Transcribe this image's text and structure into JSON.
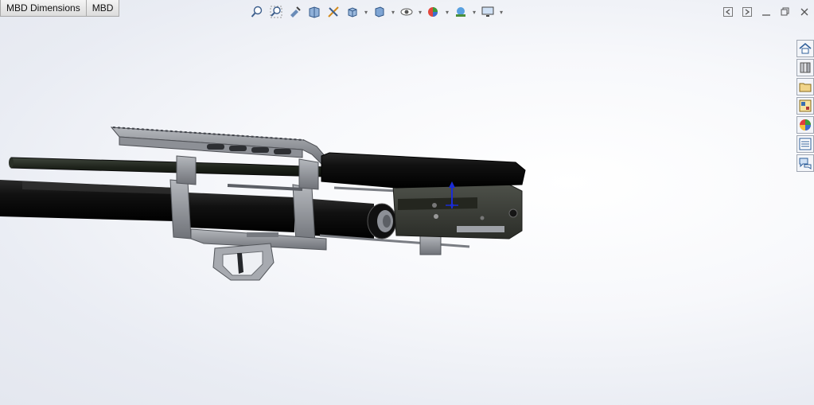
{
  "tabs": [
    {
      "label": "MBD Dimensions"
    },
    {
      "label": "MBD"
    }
  ],
  "heads_up_toolbar": {
    "buttons": [
      "zoom-to-fit-icon",
      "zoom-to-area-icon",
      "previous-view-icon",
      "section-view-icon",
      "dynamic-annotation-icon",
      "view-orientation-icon",
      "display-style-icon",
      "hide-show-items-icon",
      "edit-appearance-icon",
      "apply-scene-icon",
      "view-settings-icon"
    ]
  },
  "window_controls": [
    "restore-left-icon",
    "restore-right-icon",
    "minimize-icon",
    "maximize-icon",
    "close-icon"
  ],
  "task_pane": [
    "home-icon",
    "design-library-icon",
    "file-explorer-icon",
    "view-palette-icon",
    "appearances-icon",
    "custom-properties-icon",
    "forum-icon"
  ],
  "colors": {
    "part_black": "#0d0d0d",
    "part_grey": "#8c8f95",
    "receiver_dark": "#3b3d37",
    "triad_blue": "#1a2bd6"
  }
}
